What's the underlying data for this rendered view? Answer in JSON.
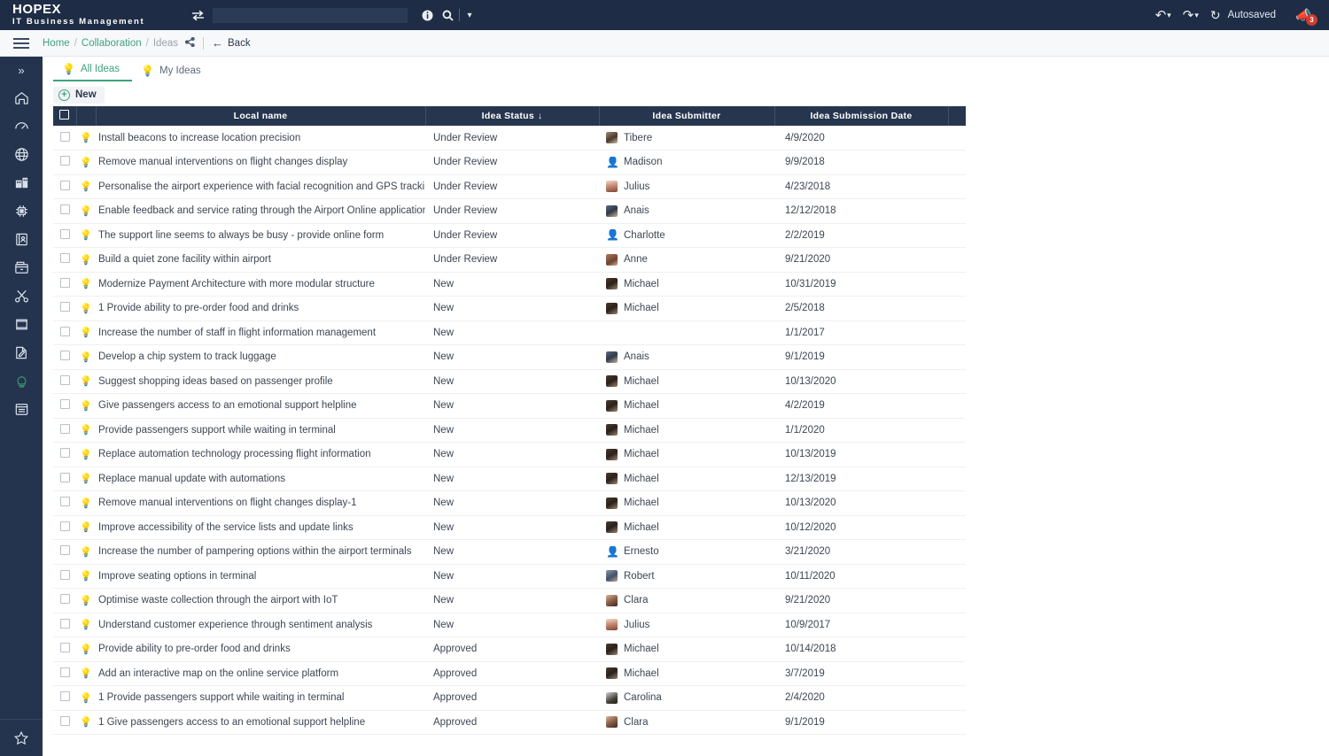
{
  "topbar": {
    "brand_line1": "HOPEX",
    "brand_line2": "IT Business Management",
    "swap_icon": "swap-icon",
    "search_value": "",
    "search_placeholder": "",
    "info_icon": "info-icon",
    "search_icon": "search-icon",
    "search_caret_icon": "chevron-down-icon",
    "undo_icon": "undo-icon",
    "undo_caret_icon": "chevron-down-icon",
    "redo_icon": "redo-icon",
    "redo_caret_icon": "chevron-down-icon",
    "sync_icon": "sync-icon",
    "autosaved_label": "Autosaved",
    "notification_icon": "megaphone-icon",
    "notification_count": "3"
  },
  "breadcrumb": {
    "menu_icon": "hamburger-icon",
    "items": [
      {
        "label": "Home",
        "current": false
      },
      {
        "label": "Collaboration",
        "current": false
      },
      {
        "label": "Ideas",
        "current": true
      }
    ],
    "separator": "/",
    "share_icon": "share-icon",
    "back_icon": "arrow-left-icon",
    "back_label": "Back"
  },
  "rail": {
    "collapse_icon": "chevrons-right-icon",
    "items": [
      {
        "name": "home-icon"
      },
      {
        "name": "dashboard-gauge-icon"
      },
      {
        "name": "globe-icon"
      },
      {
        "name": "enterprise-architecture-icon"
      },
      {
        "name": "chip-technology-icon"
      },
      {
        "name": "data-catalog-icon"
      },
      {
        "name": "archive-box-icon"
      },
      {
        "name": "scissors-icon"
      },
      {
        "name": "frame-icon"
      },
      {
        "name": "edit-document-icon"
      },
      {
        "name": "collaboration-idea-icon",
        "active": true
      },
      {
        "name": "report-window-icon"
      }
    ],
    "bottom_icon": "star-icon"
  },
  "tabs": [
    {
      "label": "All Ideas",
      "icon": "lightbulb-icon",
      "active": true
    },
    {
      "label": "My Ideas",
      "icon": "lightbulb-icon",
      "active": false
    }
  ],
  "toolbar": {
    "new_icon": "plus-circle-icon",
    "new_label": "New"
  },
  "table": {
    "select_all_icon": "checkbox-icon",
    "columns": [
      {
        "key": "name",
        "label": "Local name"
      },
      {
        "key": "status",
        "label": "Idea Status",
        "sorted": true,
        "sort_dir": "desc",
        "sort_icon": "arrow-down-icon"
      },
      {
        "key": "sub",
        "label": "Idea Submitter"
      },
      {
        "key": "date",
        "label": "Idea Submission Date"
      }
    ],
    "row_icon": "lightbulb-icon",
    "row_checkbox_icon": "checkbox-icon",
    "rows": [
      {
        "name": "Install beacons to increase location precision",
        "status": "Under Review",
        "submitter": "Tibere",
        "avatar": "av-tibere",
        "date": "4/9/2020"
      },
      {
        "name": "Remove manual interventions on flight changes display",
        "status": "Under Review",
        "submitter": "Madison",
        "avatar": "av-person",
        "date": "9/9/2018"
      },
      {
        "name": "Personalise the airport experience with facial recognition and GPS tracking",
        "status": "Under Review",
        "submitter": "Julius",
        "avatar": "av-julius",
        "date": "4/23/2018"
      },
      {
        "name": "Enable feedback and service rating through the Airport Online application",
        "status": "Under Review",
        "submitter": "Anais",
        "avatar": "av-anais",
        "date": "12/12/2018"
      },
      {
        "name": "The support line seems to always be busy - provide online form",
        "status": "Under Review",
        "submitter": "Charlotte",
        "avatar": "av-person",
        "date": "2/2/2019"
      },
      {
        "name": "Build a quiet zone facility within airport",
        "status": "Under Review",
        "submitter": "Anne",
        "avatar": "av-anne",
        "date": "9/21/2020"
      },
      {
        "name": "Modernize Payment Architecture with more modular structure",
        "status": "New",
        "submitter": "Michael",
        "avatar": "av-michael",
        "date": "10/31/2019"
      },
      {
        "name": "1 Provide ability to pre-order food and drinks",
        "status": "New",
        "submitter": "Michael",
        "avatar": "av-michael",
        "date": "2/5/2018"
      },
      {
        "name": "Increase the number of staff in flight information management",
        "status": "New",
        "submitter": "",
        "avatar": "",
        "date": "1/1/2017"
      },
      {
        "name": "Develop a chip system to track luggage",
        "status": "New",
        "submitter": "Anais",
        "avatar": "av-anais",
        "date": "9/1/2019"
      },
      {
        "name": "Suggest shopping ideas based on passenger profile",
        "status": "New",
        "submitter": "Michael",
        "avatar": "av-michael",
        "date": "10/13/2020"
      },
      {
        "name": "Give passengers access to an emotional support helpline",
        "status": "New",
        "submitter": "Michael",
        "avatar": "av-michael",
        "date": "4/2/2019"
      },
      {
        "name": "Provide passengers support while waiting in terminal",
        "status": "New",
        "submitter": "Michael",
        "avatar": "av-michael",
        "date": "1/1/2020"
      },
      {
        "name": "Replace automation technology processing flight information",
        "status": "New",
        "submitter": "Michael",
        "avatar": "av-michael",
        "date": "10/13/2019"
      },
      {
        "name": "Replace manual update with automations",
        "status": "New",
        "submitter": "Michael",
        "avatar": "av-michael",
        "date": "12/13/2019"
      },
      {
        "name": "Remove manual interventions on flight changes display-1",
        "status": "New",
        "submitter": "Michael",
        "avatar": "av-michael",
        "date": "10/13/2020"
      },
      {
        "name": "Improve accessibility of the service lists and update links",
        "status": "New",
        "submitter": "Michael",
        "avatar": "av-michael",
        "date": "10/12/2020"
      },
      {
        "name": "Increase the number of pampering options within the airport terminals",
        "status": "New",
        "submitter": "Ernesto",
        "avatar": "av-person",
        "date": "3/21/2020"
      },
      {
        "name": "Improve seating options in terminal",
        "status": "New",
        "submitter": "Robert",
        "avatar": "av-robert",
        "date": "10/11/2020"
      },
      {
        "name": "Optimise waste collection through the airport with IoT",
        "status": "New",
        "submitter": "Clara",
        "avatar": "av-clara",
        "date": "9/21/2020"
      },
      {
        "name": "Understand customer experience through sentiment analysis",
        "status": "New",
        "submitter": "Julius",
        "avatar": "av-julius",
        "date": "10/9/2017"
      },
      {
        "name": "Provide ability to pre-order food and drinks",
        "status": "Approved",
        "submitter": "Michael",
        "avatar": "av-michael",
        "date": "10/14/2018"
      },
      {
        "name": "Add an interactive map on the online service platform",
        "status": "Approved",
        "submitter": "Michael",
        "avatar": "av-michael",
        "date": "3/7/2019"
      },
      {
        "name": "1 Provide passengers support while waiting in terminal",
        "status": "Approved",
        "submitter": "Carolina",
        "avatar": "av-carolina",
        "date": "2/4/2020"
      },
      {
        "name": "1 Give passengers access to an emotional support helpline",
        "status": "Approved",
        "submitter": "Clara",
        "avatar": "av-clara",
        "date": "9/1/2019"
      }
    ]
  },
  "colors": {
    "brand_dark": "#1e2d45",
    "rail_dark": "#24344e",
    "table_header": "#27364f",
    "accent_green": "#3fa37a",
    "badge_red": "#d03a2f"
  }
}
